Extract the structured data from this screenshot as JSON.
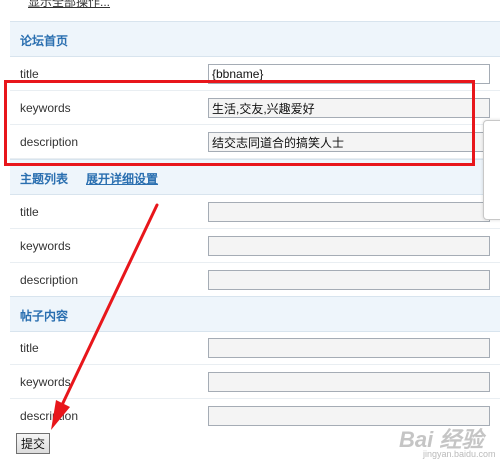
{
  "top_link": "显示全部操作...",
  "sections": [
    {
      "title": "论坛首页",
      "rows": [
        {
          "label": "title",
          "value": "{bbname}"
        },
        {
          "label": "keywords",
          "value": "生活,交友,兴趣爱好"
        },
        {
          "label": "description",
          "value": "结交志同道合的搞笑人士"
        }
      ]
    },
    {
      "title": "主题列表",
      "link": "展开详细设置",
      "rows": [
        {
          "label": "title",
          "value": ""
        },
        {
          "label": "keywords",
          "value": ""
        },
        {
          "label": "description",
          "value": ""
        }
      ]
    },
    {
      "title": "帖子内容",
      "rows": [
        {
          "label": "title",
          "value": ""
        },
        {
          "label": "keywords",
          "value": ""
        },
        {
          "label": "description",
          "value": ""
        }
      ]
    }
  ],
  "submit_label": "提交",
  "watermark": {
    "brand": "Bai 经验",
    "sub": "jingyan.baidu.com"
  },
  "colors": {
    "section_title": "#2a6fb0",
    "section_bg": "#eef5fb",
    "annotation": "#e8161b"
  }
}
